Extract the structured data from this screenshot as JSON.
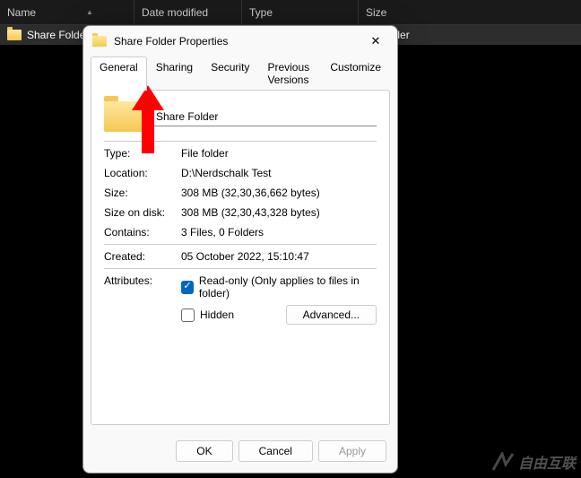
{
  "explorer": {
    "columns": {
      "name": "Name",
      "date": "Date modified",
      "type": "Type",
      "size": "Size"
    },
    "row": {
      "name": "Share Folder",
      "type_partial": "older"
    }
  },
  "dialog": {
    "title": "Share Folder Properties",
    "tabs": [
      "General",
      "Sharing",
      "Security",
      "Previous Versions",
      "Customize"
    ],
    "folder_name": "Share Folder",
    "props": {
      "type_label": "Type:",
      "type_value": "File folder",
      "location_label": "Location:",
      "location_value": "D:\\Nerdschalk Test",
      "size_label": "Size:",
      "size_value": "308 MB (32,30,36,662 bytes)",
      "size_on_disk_label": "Size on disk:",
      "size_on_disk_value": "308 MB (32,30,43,328 bytes)",
      "contains_label": "Contains:",
      "contains_value": "3 Files, 0 Folders",
      "created_label": "Created:",
      "created_value": "05 October 2022, 15:10:47",
      "attributes_label": "Attributes:"
    },
    "attrs": {
      "readonly_label": "Read-only (Only applies to files in folder)",
      "hidden_label": "Hidden",
      "advanced_label": "Advanced..."
    },
    "buttons": {
      "ok": "OK",
      "cancel": "Cancel",
      "apply": "Apply"
    }
  },
  "watermark": "自由互联"
}
